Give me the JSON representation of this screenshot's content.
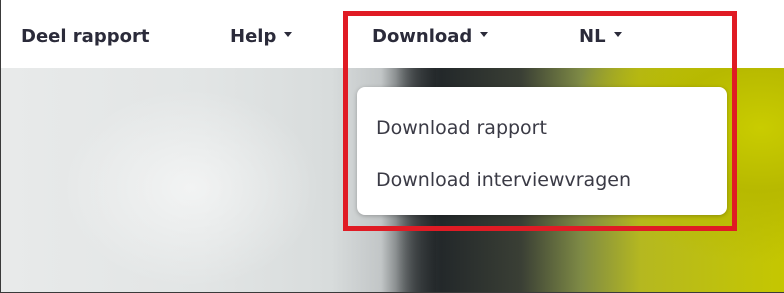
{
  "navbar": {
    "items": [
      {
        "label": "Deel rapport",
        "has_caret": false
      },
      {
        "label": "Help",
        "has_caret": true
      },
      {
        "label": "Download",
        "has_caret": true
      },
      {
        "label": "NL",
        "has_caret": true
      }
    ]
  },
  "dropdown": {
    "items": [
      {
        "label": "Download rapport"
      },
      {
        "label": "Download interviewvragen"
      }
    ]
  },
  "colors": {
    "highlight_border": "#e01b24",
    "nav_text": "#2b2b3a",
    "accent_yellow": "#c5c700"
  }
}
